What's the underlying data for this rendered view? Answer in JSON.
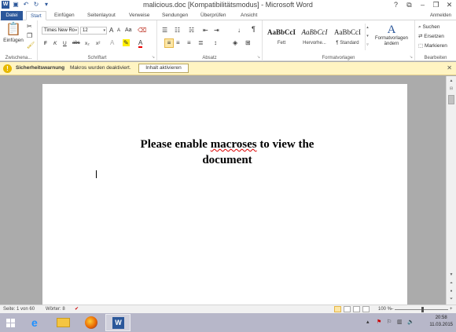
{
  "window": {
    "title": "malicious.doc [Kompatibilitätsmodus] - Microsoft Word",
    "word_icon_letter": "W",
    "controls": {
      "help": "?",
      "ribbon_toggle": "⧉",
      "minimize": "–",
      "maximize": "❐",
      "close": "✕"
    }
  },
  "tabs": {
    "file": "Datei",
    "items": [
      "Start",
      "Einfügen",
      "Seitenlayout",
      "Verweise",
      "Sendungen",
      "Überprüfen",
      "Ansicht"
    ],
    "active": "Start",
    "signin": "Anmelden"
  },
  "ribbon": {
    "clipboard": {
      "label": "Zwischena...",
      "paste": "Einfügen"
    },
    "font": {
      "label": "Schriftart",
      "font_name": "Times New Ro",
      "font_size": "12",
      "grow": "A",
      "shrink": "A",
      "change_case": "Aa",
      "bold": "F",
      "italic": "K",
      "underline": "U",
      "strike": "abc",
      "subscript": "x₂",
      "superscript": "x²",
      "font_color": "A"
    },
    "paragraph": {
      "label": "Absatz",
      "pilcrow": "¶",
      "sort": "↓"
    },
    "styles": {
      "label": "Formatvorlagen",
      "items": [
        {
          "sample": "AaBbCcI",
          "name": "Fett"
        },
        {
          "sample": "AaBbCcI",
          "name": "Hervorhe..."
        },
        {
          "sample": "AaBbCcI",
          "name": "¶ Standard"
        }
      ],
      "change_styles": "Formatvorlagen ändern"
    },
    "editing": {
      "label": "Bearbeiten",
      "find": "Suchen",
      "replace": "Ersetzen",
      "select": "Markieren"
    }
  },
  "security_bar": {
    "icon": "!",
    "title": "Sicherheitswarnung",
    "message": "Makros wurden deaktiviert.",
    "button": "Inhalt aktivieren",
    "close": "✕"
  },
  "document": {
    "heading_pre": "Please enable ",
    "heading_spell": "macroses",
    "heading_post": " to view the document"
  },
  "statusbar": {
    "page": "Seite: 1 von 60",
    "words": "Wörter: 8",
    "zoom": "100 %",
    "zoom_minus": "–",
    "zoom_plus": "+",
    "zoom_level_percent": 100
  },
  "taskbar": {
    "apps": [
      "start-icon",
      "internet-explorer-icon",
      "file-explorer-icon",
      "firefox-icon",
      "word-icon"
    ],
    "time": "20:58",
    "date": "11.03.2015"
  },
  "colors": {
    "accent": "#2b579a",
    "security_bar_bg": "#fff4c2",
    "taskbar": "#b7b7c9"
  }
}
